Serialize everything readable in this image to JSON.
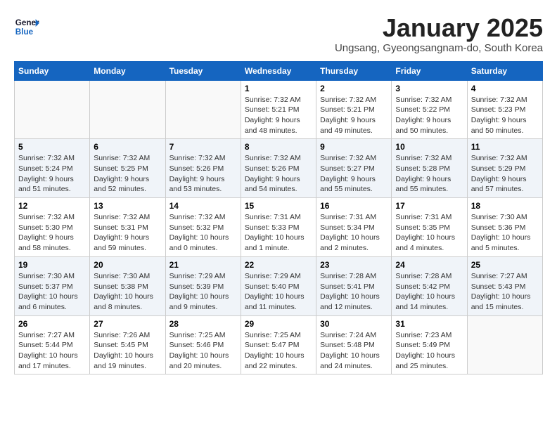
{
  "header": {
    "logo": {
      "line1": "General",
      "line2": "Blue"
    },
    "title": "January 2025",
    "subtitle": "Ungsang, Gyeongsangnam-do, South Korea"
  },
  "weekdays": [
    "Sunday",
    "Monday",
    "Tuesday",
    "Wednesday",
    "Thursday",
    "Friday",
    "Saturday"
  ],
  "weeks": [
    [
      {
        "day": "",
        "info": ""
      },
      {
        "day": "",
        "info": ""
      },
      {
        "day": "",
        "info": ""
      },
      {
        "day": "1",
        "info": "Sunrise: 7:32 AM\nSunset: 5:21 PM\nDaylight: 9 hours\nand 48 minutes."
      },
      {
        "day": "2",
        "info": "Sunrise: 7:32 AM\nSunset: 5:21 PM\nDaylight: 9 hours\nand 49 minutes."
      },
      {
        "day": "3",
        "info": "Sunrise: 7:32 AM\nSunset: 5:22 PM\nDaylight: 9 hours\nand 50 minutes."
      },
      {
        "day": "4",
        "info": "Sunrise: 7:32 AM\nSunset: 5:23 PM\nDaylight: 9 hours\nand 50 minutes."
      }
    ],
    [
      {
        "day": "5",
        "info": "Sunrise: 7:32 AM\nSunset: 5:24 PM\nDaylight: 9 hours\nand 51 minutes."
      },
      {
        "day": "6",
        "info": "Sunrise: 7:32 AM\nSunset: 5:25 PM\nDaylight: 9 hours\nand 52 minutes."
      },
      {
        "day": "7",
        "info": "Sunrise: 7:32 AM\nSunset: 5:26 PM\nDaylight: 9 hours\nand 53 minutes."
      },
      {
        "day": "8",
        "info": "Sunrise: 7:32 AM\nSunset: 5:26 PM\nDaylight: 9 hours\nand 54 minutes."
      },
      {
        "day": "9",
        "info": "Sunrise: 7:32 AM\nSunset: 5:27 PM\nDaylight: 9 hours\nand 55 minutes."
      },
      {
        "day": "10",
        "info": "Sunrise: 7:32 AM\nSunset: 5:28 PM\nDaylight: 9 hours\nand 55 minutes."
      },
      {
        "day": "11",
        "info": "Sunrise: 7:32 AM\nSunset: 5:29 PM\nDaylight: 9 hours\nand 57 minutes."
      }
    ],
    [
      {
        "day": "12",
        "info": "Sunrise: 7:32 AM\nSunset: 5:30 PM\nDaylight: 9 hours\nand 58 minutes."
      },
      {
        "day": "13",
        "info": "Sunrise: 7:32 AM\nSunset: 5:31 PM\nDaylight: 9 hours\nand 59 minutes."
      },
      {
        "day": "14",
        "info": "Sunrise: 7:32 AM\nSunset: 5:32 PM\nDaylight: 10 hours\nand 0 minutes."
      },
      {
        "day": "15",
        "info": "Sunrise: 7:31 AM\nSunset: 5:33 PM\nDaylight: 10 hours\nand 1 minute."
      },
      {
        "day": "16",
        "info": "Sunrise: 7:31 AM\nSunset: 5:34 PM\nDaylight: 10 hours\nand 2 minutes."
      },
      {
        "day": "17",
        "info": "Sunrise: 7:31 AM\nSunset: 5:35 PM\nDaylight: 10 hours\nand 4 minutes."
      },
      {
        "day": "18",
        "info": "Sunrise: 7:30 AM\nSunset: 5:36 PM\nDaylight: 10 hours\nand 5 minutes."
      }
    ],
    [
      {
        "day": "19",
        "info": "Sunrise: 7:30 AM\nSunset: 5:37 PM\nDaylight: 10 hours\nand 6 minutes."
      },
      {
        "day": "20",
        "info": "Sunrise: 7:30 AM\nSunset: 5:38 PM\nDaylight: 10 hours\nand 8 minutes."
      },
      {
        "day": "21",
        "info": "Sunrise: 7:29 AM\nSunset: 5:39 PM\nDaylight: 10 hours\nand 9 minutes."
      },
      {
        "day": "22",
        "info": "Sunrise: 7:29 AM\nSunset: 5:40 PM\nDaylight: 10 hours\nand 11 minutes."
      },
      {
        "day": "23",
        "info": "Sunrise: 7:28 AM\nSunset: 5:41 PM\nDaylight: 10 hours\nand 12 minutes."
      },
      {
        "day": "24",
        "info": "Sunrise: 7:28 AM\nSunset: 5:42 PM\nDaylight: 10 hours\nand 14 minutes."
      },
      {
        "day": "25",
        "info": "Sunrise: 7:27 AM\nSunset: 5:43 PM\nDaylight: 10 hours\nand 15 minutes."
      }
    ],
    [
      {
        "day": "26",
        "info": "Sunrise: 7:27 AM\nSunset: 5:44 PM\nDaylight: 10 hours\nand 17 minutes."
      },
      {
        "day": "27",
        "info": "Sunrise: 7:26 AM\nSunset: 5:45 PM\nDaylight: 10 hours\nand 19 minutes."
      },
      {
        "day": "28",
        "info": "Sunrise: 7:25 AM\nSunset: 5:46 PM\nDaylight: 10 hours\nand 20 minutes."
      },
      {
        "day": "29",
        "info": "Sunrise: 7:25 AM\nSunset: 5:47 PM\nDaylight: 10 hours\nand 22 minutes."
      },
      {
        "day": "30",
        "info": "Sunrise: 7:24 AM\nSunset: 5:48 PM\nDaylight: 10 hours\nand 24 minutes."
      },
      {
        "day": "31",
        "info": "Sunrise: 7:23 AM\nSunset: 5:49 PM\nDaylight: 10 hours\nand 25 minutes."
      },
      {
        "day": "",
        "info": ""
      }
    ]
  ]
}
